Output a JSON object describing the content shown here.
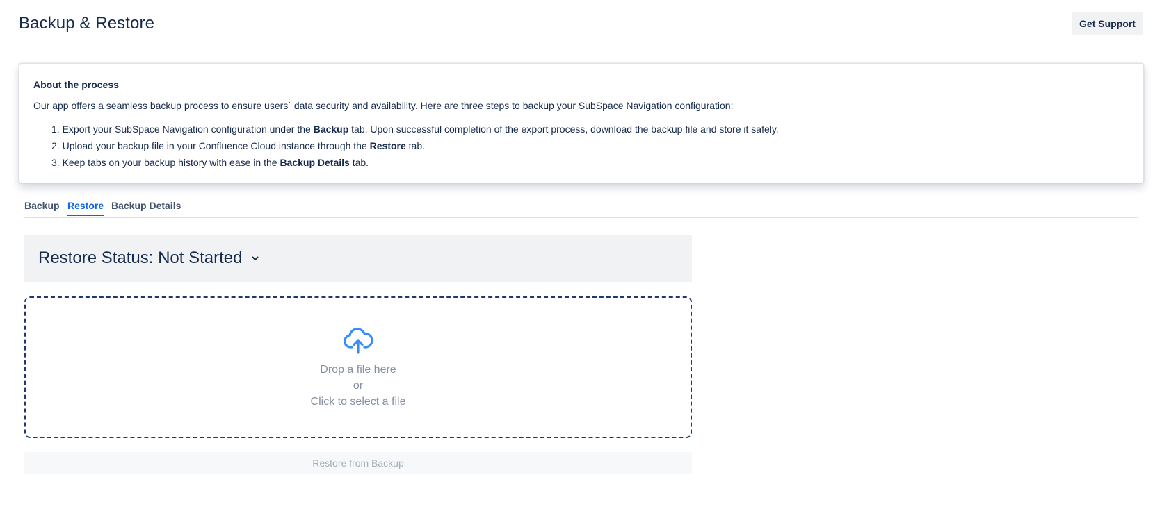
{
  "header": {
    "title": "Backup & Restore",
    "support_label": "Get Support"
  },
  "about": {
    "title": "About the process",
    "intro": "Our app offers a seamless backup process to ensure users` data security and availability. Here are three steps to backup your SubSpace Navigation configuration:",
    "steps": [
      {
        "num": "1.",
        "before": "Export your SubSpace Navigation configuration under the ",
        "bold": "Backup",
        "after": " tab. Upon successful completion of the export process, download the backup file and store it safely."
      },
      {
        "num": "2.",
        "before": "Upload your backup file in your Confluence Cloud instance through the ",
        "bold": "Restore",
        "after": " tab."
      },
      {
        "num": "3.",
        "before": "Keep tabs on your backup history with ease in the ",
        "bold": "Backup Details",
        "after": " tab."
      }
    ]
  },
  "tabs": [
    {
      "label": "Backup",
      "active": false
    },
    {
      "label": "Restore",
      "active": true
    },
    {
      "label": "Backup Details",
      "active": false
    }
  ],
  "restore": {
    "status_text": "Restore Status: Not Started",
    "chevron_icon": "chevron-down-icon",
    "dropzone": {
      "icon": "cloud-upload-icon",
      "line1": "Drop a file here",
      "line2": "or",
      "line3": "Click to select a file"
    },
    "button_label": "Restore from Backup",
    "button_disabled": true
  },
  "colors": {
    "accent": "#0c66e4",
    "upload_icon": "#388bff",
    "dropzone_border": "#1c3a6b",
    "text": "#172b4d"
  }
}
